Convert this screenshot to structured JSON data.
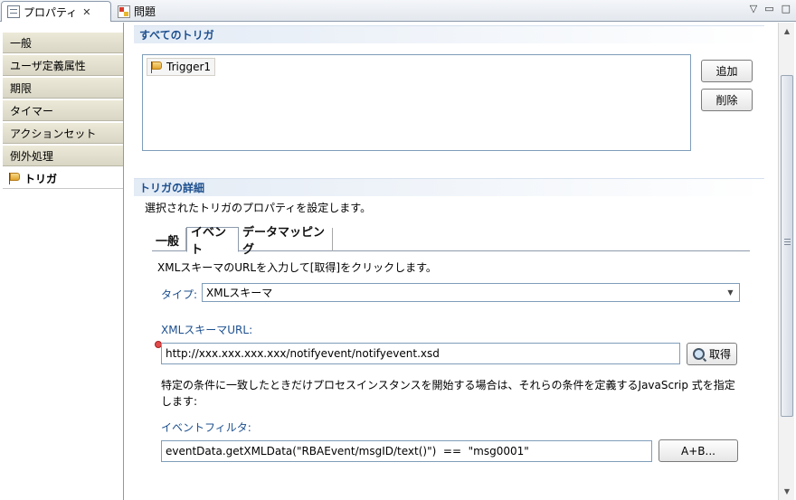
{
  "view_tabs": {
    "properties": {
      "label": "プロパティ",
      "icon": "properties-icon"
    },
    "problems": {
      "label": "問題",
      "icon": "problems-icon"
    },
    "close_glyph": "✕"
  },
  "window_controls": {
    "menu": "▽",
    "minimize": "▭",
    "maximize": "□"
  },
  "sidebar": {
    "items": [
      {
        "label": "一般"
      },
      {
        "label": "ユーザ定義属性"
      },
      {
        "label": "期限"
      },
      {
        "label": "タイマー"
      },
      {
        "label": "アクションセット"
      },
      {
        "label": "例外処理"
      },
      {
        "label": "トリガ",
        "selected": true,
        "icon": "flag-icon"
      }
    ]
  },
  "all_triggers": {
    "title": "すべてのトリガ",
    "items": [
      {
        "label": "Trigger1",
        "icon": "flag-icon"
      }
    ],
    "add_label": "追加",
    "delete_label": "削除"
  },
  "trigger_details": {
    "title": "トリガの詳細",
    "description": "選択されたトリガのプロパティを設定します。",
    "tabs": [
      {
        "label": "一般"
      },
      {
        "label": "イベント",
        "active": true
      },
      {
        "label": "データマッピング"
      }
    ],
    "instruction": "XMLスキーマのURLを入力して[取得]をクリックします。",
    "type_label": "タイプ:",
    "type_value": "XMLスキーマ",
    "schema_url_label": "XMLスキーマURL:",
    "schema_url_value": "http://xxx.xxx.xxx.xxx/notifyevent/notifyevent.xsd",
    "fetch_label": "取得",
    "condition_text_line1": "特定の条件に一致したときだけプロセスインスタンスを開始する場合は、それらの条件を定義するJavaScrip 式を指定",
    "condition_text_line2": "します:",
    "filter_label": "イベントフィルタ:",
    "filter_value": "eventData.getXMLData(\"RBAEvent/msgID/text()\")  ==  \"msg0001\"",
    "expression_button_label": "A+B..."
  },
  "colors": {
    "section_title": "#1c4f8e",
    "error": "#e24b4b",
    "border": "#7f9db9"
  }
}
